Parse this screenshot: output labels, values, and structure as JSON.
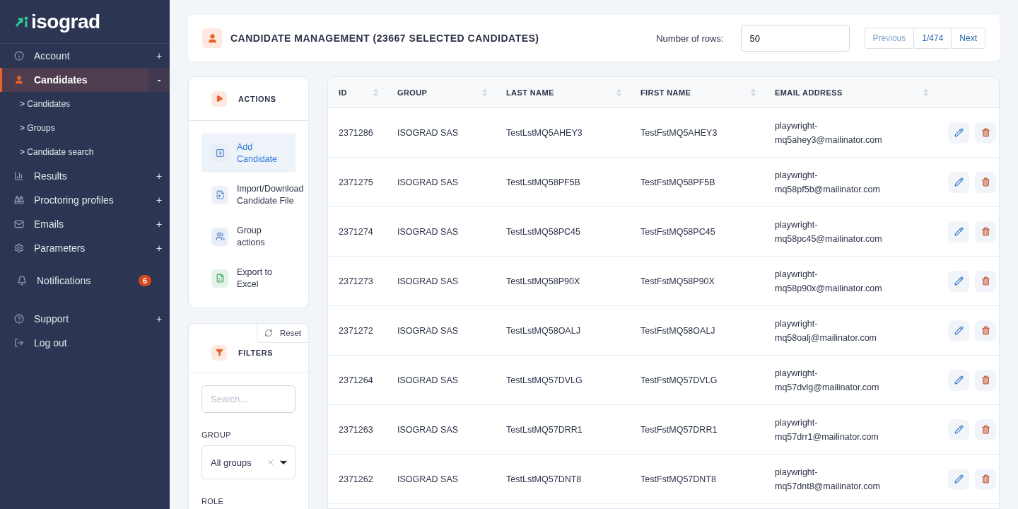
{
  "sidebar": {
    "logo": "isograd",
    "items": [
      {
        "label": "Account",
        "toggle": "+",
        "selected": false
      },
      {
        "label": "Candidates",
        "toggle": "-",
        "selected": true,
        "children": [
          {
            "label": "> Candidates"
          },
          {
            "label": "> Groups"
          },
          {
            "label": "> Candidate search"
          }
        ]
      },
      {
        "label": "Results",
        "toggle": "+",
        "selected": false
      },
      {
        "label": "Proctoring profiles",
        "toggle": "+",
        "selected": false
      },
      {
        "label": "Emails",
        "toggle": "+",
        "selected": false
      },
      {
        "label": "Parameters",
        "toggle": "+",
        "selected": false
      },
      {
        "label": "Notifications",
        "badge": "6",
        "selected": false
      },
      {
        "label": "Support",
        "toggle": "+",
        "selected": false
      },
      {
        "label": "Log out",
        "selected": false
      }
    ]
  },
  "header": {
    "title": "CANDIDATE MANAGEMENT (23667 SELECTED CANDIDATES)",
    "rows_label": "Number of rows:",
    "rows_value": "50",
    "pagination": [
      {
        "label": "Previous",
        "disabled": true
      },
      {
        "label": "1/474",
        "disabled": false
      },
      {
        "label": "Next",
        "disabled": false
      }
    ]
  },
  "actions": {
    "title": "ACTIONS",
    "items": [
      {
        "label": "Add Candidate",
        "selected": true
      },
      {
        "label": "Import/Download Candidate File",
        "selected": false
      },
      {
        "label": "Group actions",
        "selected": false
      },
      {
        "label": "Export to Excel",
        "selected": false
      }
    ]
  },
  "filters": {
    "title": "FILTERS",
    "reset": "Reset",
    "search_placeholder": "Search...",
    "group_label": "GROUP",
    "group_value": "All groups",
    "role_label": "ROLE"
  },
  "table": {
    "columns": [
      "ID",
      "GROUP",
      "LAST NAME",
      "FIRST NAME",
      "EMAIL ADDRESS"
    ],
    "rows": [
      [
        "2371286",
        "ISOGRAD SAS",
        "TestLstMQ5AHEY3",
        "TestFstMQ5AHEY3",
        "playwright-mq5ahey3@mailinator.com"
      ],
      [
        "2371275",
        "ISOGRAD SAS",
        "TestLstMQ58PF5B",
        "TestFstMQ58PF5B",
        "playwright-mq58pf5b@mailinator.com"
      ],
      [
        "2371274",
        "ISOGRAD SAS",
        "TestLstMQ58PC45",
        "TestFstMQ58PC45",
        "playwright-mq58pc45@mailinator.com"
      ],
      [
        "2371273",
        "ISOGRAD SAS",
        "TestLstMQ58P90X",
        "TestFstMQ58P90X",
        "playwright-mq58p90x@mailinator.com"
      ],
      [
        "2371272",
        "ISOGRAD SAS",
        "TestLstMQ58OALJ",
        "TestFstMQ58OALJ",
        "playwright-mq58oalj@mailinator.com"
      ],
      [
        "2371264",
        "ISOGRAD SAS",
        "TestLstMQ57DVLG",
        "TestFstMQ57DVLG",
        "playwright-mq57dvlg@mailinator.com"
      ],
      [
        "2371263",
        "ISOGRAD SAS",
        "TestLstMQ57DRR1",
        "TestFstMQ57DRR1",
        "playwright-mq57drr1@mailinator.com"
      ],
      [
        "2371262",
        "ISOGRAD SAS",
        "TestLstMQ57DNT8",
        "TestFstMQ57DNT8",
        "playwright-mq57dnt8@mailinator.com"
      ]
    ]
  }
}
